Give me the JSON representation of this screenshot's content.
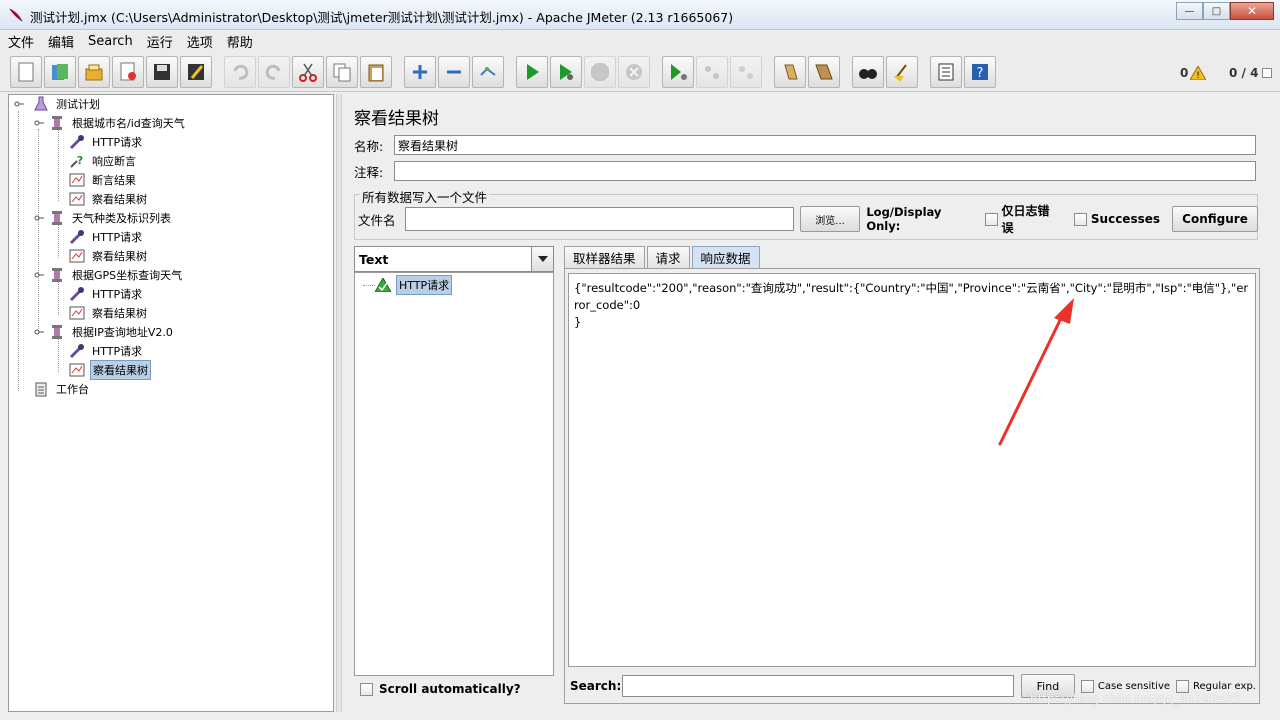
{
  "window": {
    "title": "测试计划.jmx (C:\\Users\\Administrator\\Desktop\\测试\\jmeter测试计划\\测试计划.jmx) - Apache JMeter (2.13 r1665067)",
    "minimize": "—",
    "maximize": "□",
    "close": "✕"
  },
  "menu": [
    "文件",
    "编辑",
    "Search",
    "运行",
    "选项",
    "帮助"
  ],
  "toolbar": {
    "error_count": "0",
    "thread_count": "0 / 4"
  },
  "tree": {
    "root": "测试计划",
    "groups": [
      {
        "label": "根据城市名/id查询天气",
        "children": [
          "HTTP请求",
          "响应断言",
          "断言结果",
          "察看结果树"
        ]
      },
      {
        "label": "天气种类及标识列表",
        "children": [
          "HTTP请求",
          "察看结果树"
        ]
      },
      {
        "label": "根据GPS坐标查询天气",
        "children": [
          "HTTP请求",
          "察看结果树"
        ]
      },
      {
        "label": "根据IP查询地址V2.0",
        "children": [
          "HTTP请求",
          "察看结果树"
        ]
      }
    ],
    "workbench": "工作台"
  },
  "panel": {
    "title": "察看结果树",
    "name_label": "名称:",
    "name_value": "察看结果树",
    "comment_label": "注释:",
    "comment_value": "",
    "file_group": "所有数据写入一个文件",
    "filename_label": "文件名",
    "filename_value": "",
    "browse": "浏览...",
    "log_display": "Log/Display Only:",
    "errors_only": "仅日志错误",
    "successes": "Successes",
    "configure": "Configure"
  },
  "results": {
    "renderer": "Text",
    "sample": "HTTP请求",
    "scroll_auto": "Scroll automatically?",
    "tabs": [
      "取样器结果",
      "请求",
      "响应数据"
    ],
    "active_tab": 2,
    "response_text": "{\"resultcode\":\"200\",\"reason\":\"查询成功\",\"result\":{\"Country\":\"中国\",\"Province\":\"云南省\",\"City\":\"昆明市\",\"Isp\":\"电信\"},\"error_code\":0\n}",
    "search_label": "Search:",
    "search_value": "",
    "find": "Find",
    "case_sensitive": "Case sensitive",
    "regular_exp": "Regular exp."
  },
  "watermark": "https://blog.csdn.net/qq_41782425",
  "colors": {
    "selection": "#b8cfe5",
    "active_tab": "#d4e2f1",
    "annotation_arrow": "#e8322a"
  }
}
